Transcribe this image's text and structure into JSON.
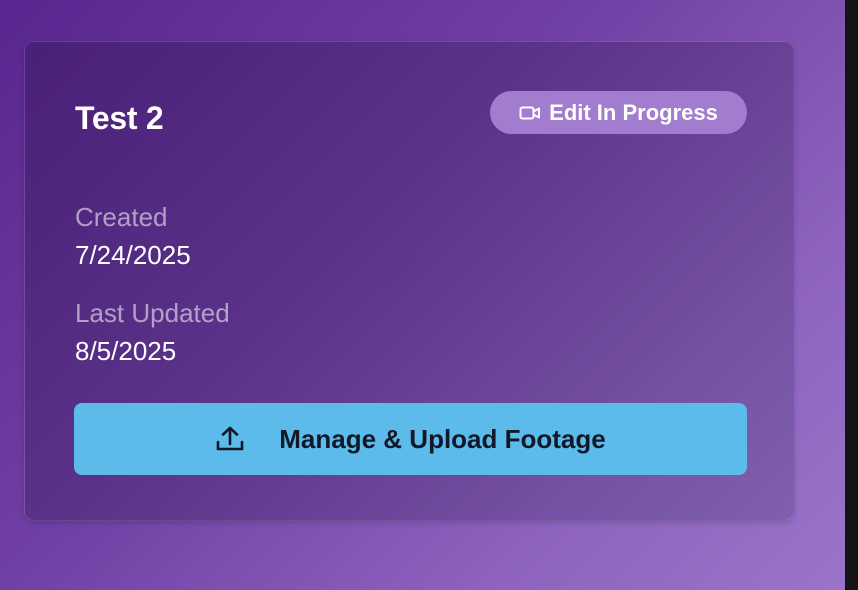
{
  "project": {
    "title": "Test 2",
    "status_badge": {
      "label": "Edit In Progress",
      "icon": "video-camera-icon",
      "color": "#a27ccf"
    },
    "created": {
      "label": "Created",
      "value": "7/24/2025"
    },
    "last_updated": {
      "label": "Last Updated",
      "value": "8/5/2025"
    },
    "action_button": {
      "label": "Manage & Upload Footage",
      "icon": "upload-icon",
      "color": "#5cbbea"
    }
  },
  "colors": {
    "background_gradient": [
      "#57278f",
      "#9a74c9"
    ],
    "text_primary": "#ffffff",
    "text_muted": "rgba(255,255,255,0.55)"
  }
}
